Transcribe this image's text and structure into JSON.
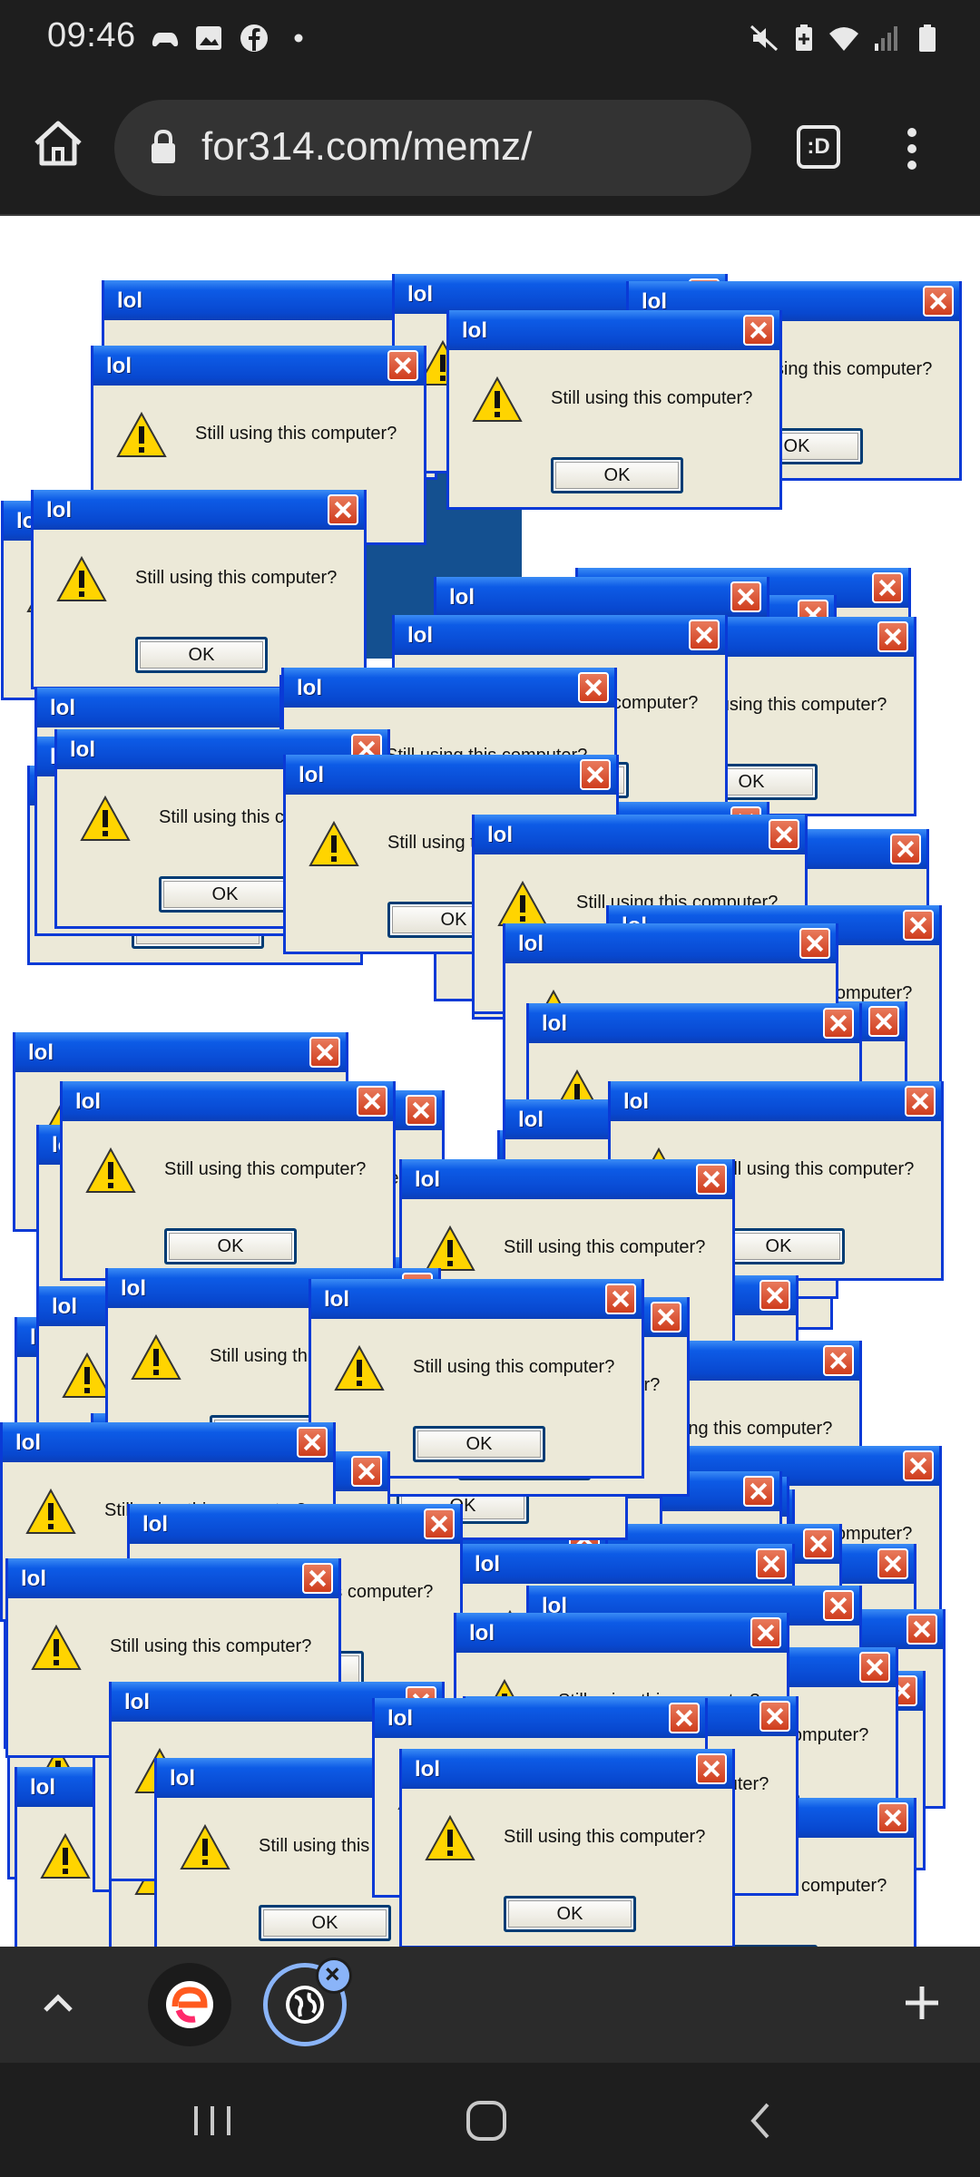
{
  "status_bar": {
    "time": "09:46",
    "left_icons": [
      "game-controller-icon",
      "image-icon",
      "facebook-icon",
      "dot-icon"
    ],
    "right_icons": [
      "mute-icon",
      "battery-saver-icon",
      "wifi-icon",
      "signal-icon",
      "battery-icon"
    ]
  },
  "browser": {
    "url": "for314.com/memz/",
    "tabs_button_label": ":D"
  },
  "dialog": {
    "title": "lol",
    "message": "Still using this computer?",
    "ok_label": "OK"
  },
  "tab_strip": {
    "tabs": [
      "e-browser-tab",
      "globe-tab"
    ]
  },
  "colors": {
    "titlebar_blue": "#0848d0",
    "dialog_body": "#ece9d8",
    "close_red": "#cf3d1d",
    "tab_highlight": "#8ab4f8"
  }
}
